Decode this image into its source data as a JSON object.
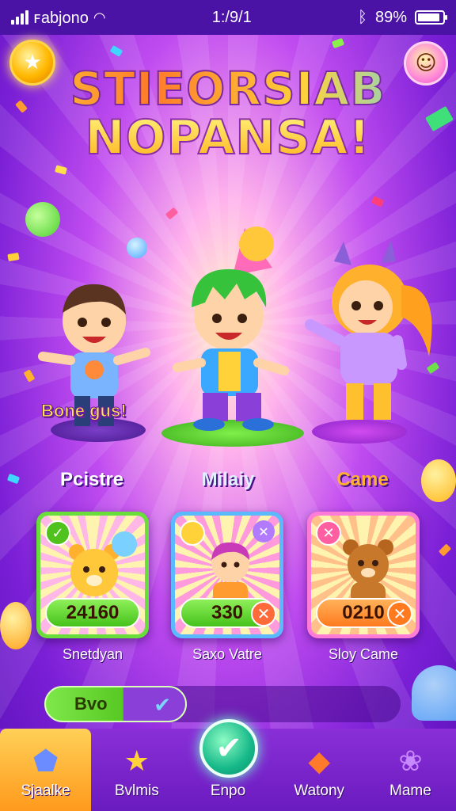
{
  "status_bar": {
    "carrier": "ꜰabjono",
    "time": "1:/9/1",
    "battery": "89%",
    "battery_level": 0.89
  },
  "title": {
    "line1": "STIEORSIAB",
    "line2": "NOPANSA!"
  },
  "characters": [
    {
      "name": "Pcistre",
      "tag": "Bone gus!"
    },
    {
      "name": "Milaiy"
    },
    {
      "name": "Came"
    }
  ],
  "cards": [
    {
      "value": "24160",
      "caption": "Snetdyan"
    },
    {
      "value": "330",
      "caption": "Saxo Vatre"
    },
    {
      "value": "0210",
      "caption": "Sloy Came"
    }
  ],
  "bonus": {
    "label": "Bvo"
  },
  "nav": [
    {
      "label": "Sjaalke",
      "icon": "puzzle-piece-icon"
    },
    {
      "label": "Bvlmis",
      "icon": "star-icon"
    },
    {
      "label": "Enpo",
      "icon": "checkmark-icon"
    },
    {
      "label": "Watony",
      "icon": "gem-icon"
    },
    {
      "label": "Mame",
      "icon": "candy-icon"
    }
  ],
  "colors": {
    "background": "#7a1fd6",
    "title_gold": "#ffd23a",
    "nav_active": "#ffb12e",
    "card_green": "#69dd3a",
    "card_blue": "#5ab9ff",
    "card_pink": "#ff7cd6",
    "center_button": "#16b889"
  }
}
